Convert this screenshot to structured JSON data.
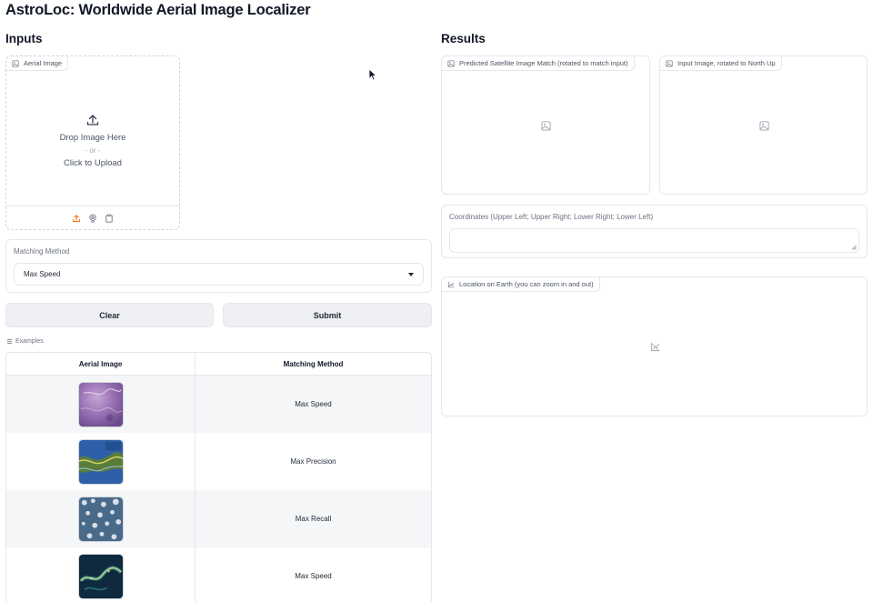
{
  "app": {
    "title": "AstroLoc: Worldwide Aerial Image Localizer"
  },
  "inputs": {
    "heading": "Inputs",
    "aerial_image": {
      "label": "Aerial Image",
      "drop_text": "Drop Image Here",
      "or_text": "- or -",
      "click_text": "Click to Upload",
      "source_icons": [
        "upload-icon",
        "webcam-icon",
        "clipboard-icon"
      ]
    },
    "matching_method": {
      "label": "Matching Method",
      "value": "Max Speed"
    },
    "buttons": {
      "clear": "Clear",
      "submit": "Submit"
    }
  },
  "examples": {
    "label": "Examples",
    "headers": [
      "Aerial Image",
      "Matching Method"
    ],
    "rows": [
      {
        "method": "Max Speed",
        "thumb": "purple-terrain"
      },
      {
        "method": "Max Precision",
        "thumb": "coastline-blue"
      },
      {
        "method": "Max Recall",
        "thumb": "cloudy-ocean"
      },
      {
        "method": "Max Speed",
        "thumb": "night-lights"
      }
    ]
  },
  "results": {
    "heading": "Results",
    "predicted_label": "Predicted Satellite Image Match (rotated to match input)",
    "input_rotated_label": "Input Image, rotated to North Up",
    "coordinates_label": "Coordinates (Upper Left; Upper Right; Lower Right; Lower Left)",
    "coordinates_value": "",
    "map_label": "Location on Earth (you can zoom in and out)"
  },
  "colors": {
    "accent": "#f97316",
    "border": "#e5e7eb",
    "button_bg": "#eef0f3"
  }
}
